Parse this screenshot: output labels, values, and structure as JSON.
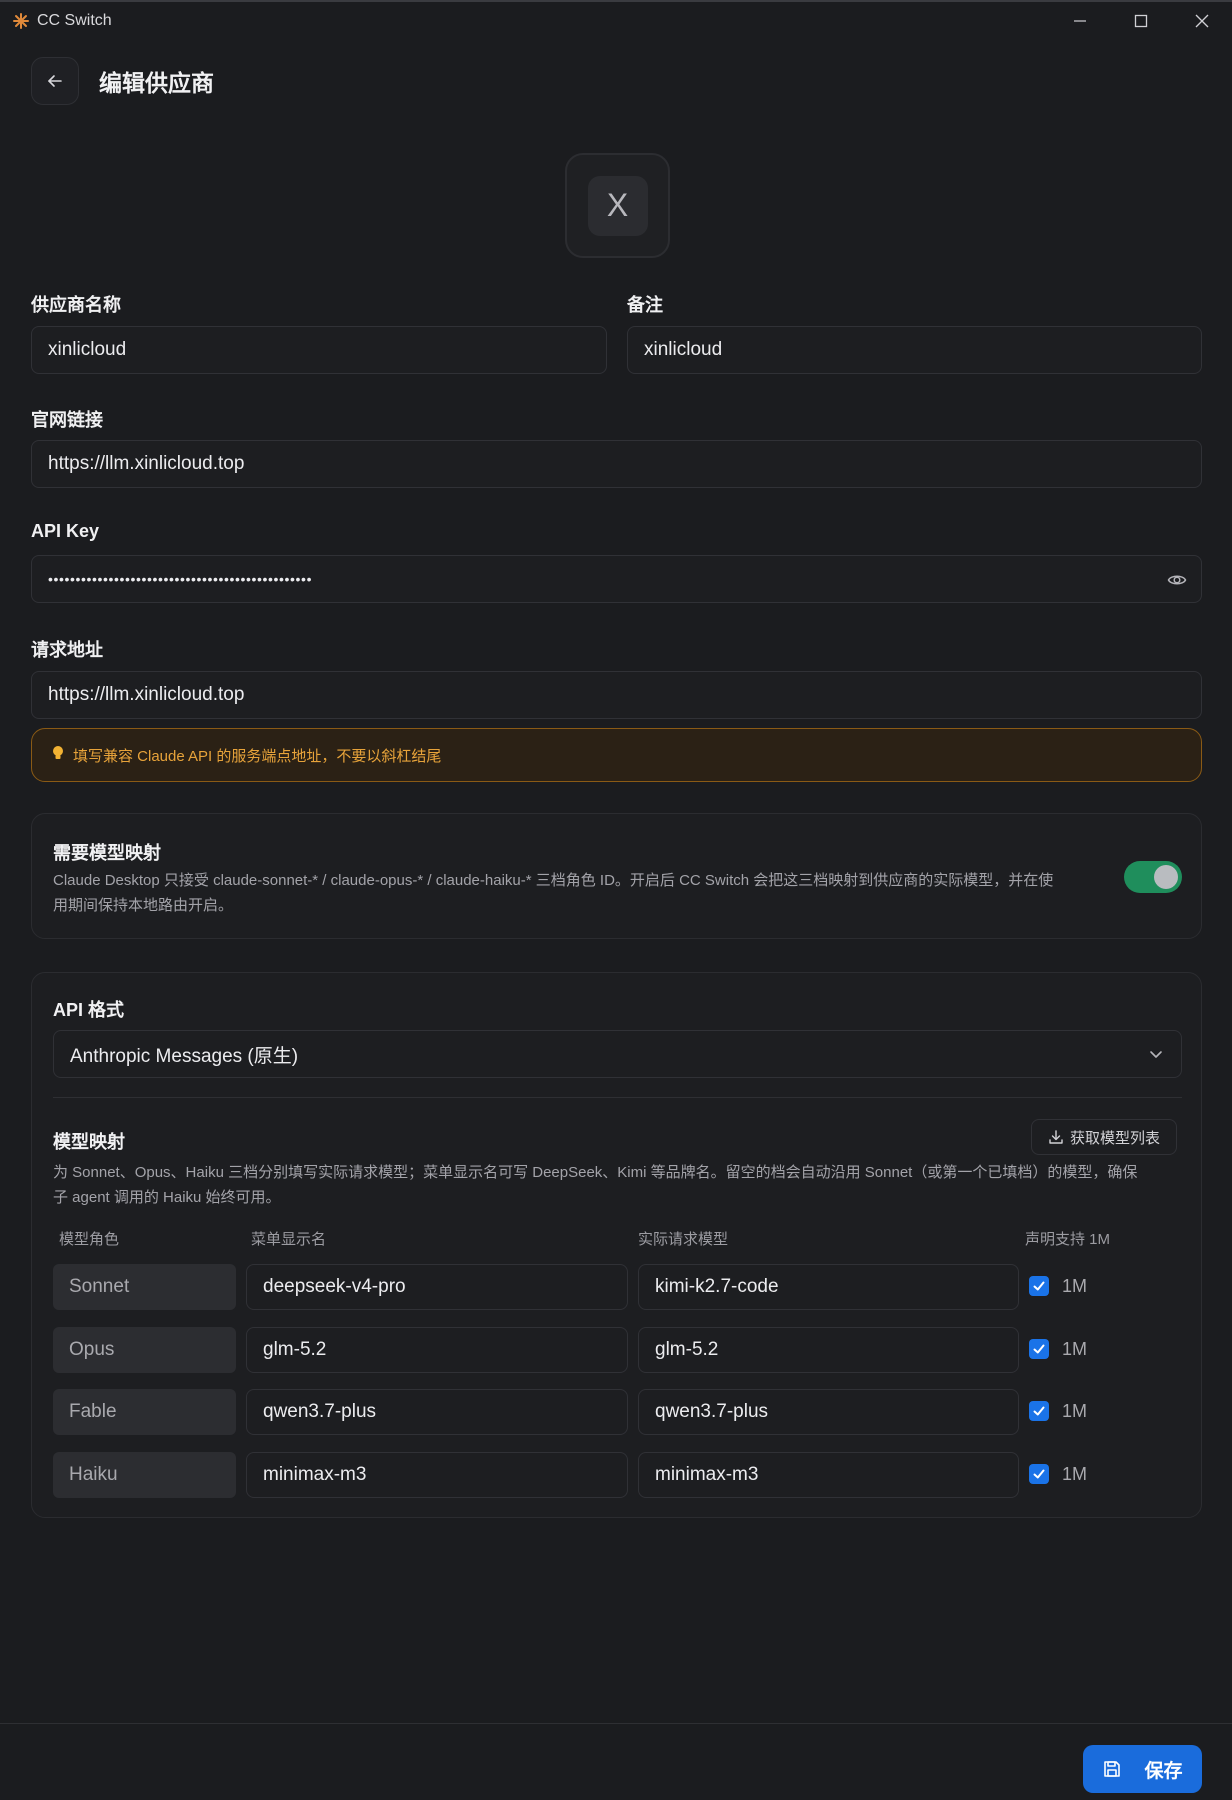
{
  "window": {
    "title": "CC Switch"
  },
  "header": {
    "title": "编辑供应商"
  },
  "logo": {
    "letter": "X"
  },
  "fields": {
    "name_label": "供应商名称",
    "name_value": "xinlicloud",
    "note_label": "备注",
    "note_value": "xinlicloud",
    "website_label": "官网链接",
    "website_value": "https://llm.xinlicloud.top",
    "apikey_label": "API Key",
    "apikey_value": "••••••••••••••••••••••••••••••••••••••••••••••••",
    "endpoint_label": "请求地址",
    "endpoint_value": "https://llm.xinlicloud.top"
  },
  "hint": {
    "text": "填写兼容 Claude API 的服务端点地址，不要以斜杠结尾"
  },
  "mapping_toggle": {
    "title": "需要模型映射",
    "description_line1": "Claude Desktop 只接受 claude-sonnet-* / claude-opus-* / claude-haiku-* 三档角色 ID。开启后 CC Switch 会把这三档映射到供应商的实际模型，并在使",
    "description_line2": "用期间保持本地路由开启。",
    "enabled": true
  },
  "api_format": {
    "label": "API 格式",
    "selected": "Anthropic Messages (原生)"
  },
  "model_mapping": {
    "title": "模型映射",
    "fetch_button": "获取模型列表",
    "description_line1": "为 Sonnet、Opus、Haiku 三档分别填写实际请求模型；菜单显示名可写 DeepSeek、Kimi 等品牌名。留空的档会自动沿用 Sonnet（或第一个已填档）的模型，确保",
    "description_line2": "子 agent 调用的 Haiku 始终可用。",
    "columns": [
      "模型角色",
      "菜单显示名",
      "实际请求模型",
      "声明支持 1M"
    ],
    "rows": [
      {
        "role": "Sonnet",
        "display": "deepseek-v4-pro",
        "model": "kimi-k2.7-code",
        "support_1m": true,
        "label_1m": "1M"
      },
      {
        "role": "Opus",
        "display": "glm-5.2",
        "model": "glm-5.2",
        "support_1m": true,
        "label_1m": "1M"
      },
      {
        "role": "Fable",
        "display": "qwen3.7-plus",
        "model": "qwen3.7-plus",
        "support_1m": true,
        "label_1m": "1M"
      },
      {
        "role": "Haiku",
        "display": "minimax-m3",
        "model": "minimax-m3",
        "support_1m": true,
        "label_1m": "1M"
      }
    ]
  },
  "footer": {
    "save_label": "保存"
  },
  "colors": {
    "accent": "#1a6cdc",
    "toggle_on": "#1f8e5c",
    "hint": "#e7a33a",
    "background": "#1b1c1f"
  }
}
